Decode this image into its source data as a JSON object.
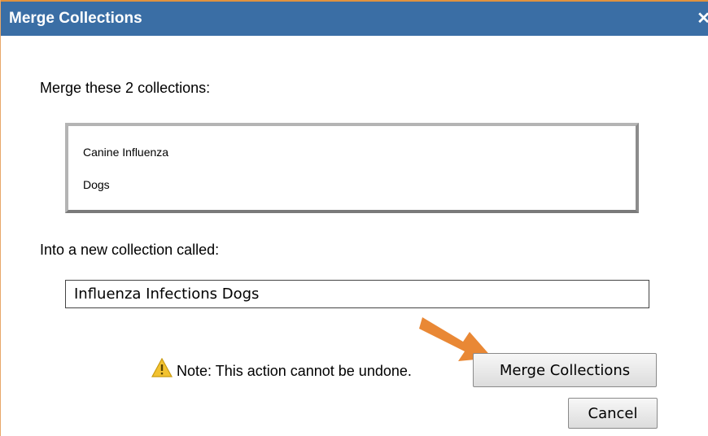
{
  "dialog": {
    "title": "Merge Collections",
    "close_glyph": "✕",
    "merge_prompt": "Merge these 2 collections:",
    "collections": [
      "Canine Influenza",
      "Dogs"
    ],
    "into_label": "Into a new collection called:",
    "new_collection_name": "Influenza Infections Dogs",
    "note": "Note: This action cannot be undone.",
    "merge_button": "Merge Collections",
    "cancel_button": "Cancel"
  },
  "colors": {
    "titlebar": "#3a6ea5",
    "annotation_arrow": "#e8822a",
    "warning_icon": "#f2c230"
  },
  "icons": [
    "close-icon",
    "warning-icon",
    "annotation-arrow"
  ]
}
